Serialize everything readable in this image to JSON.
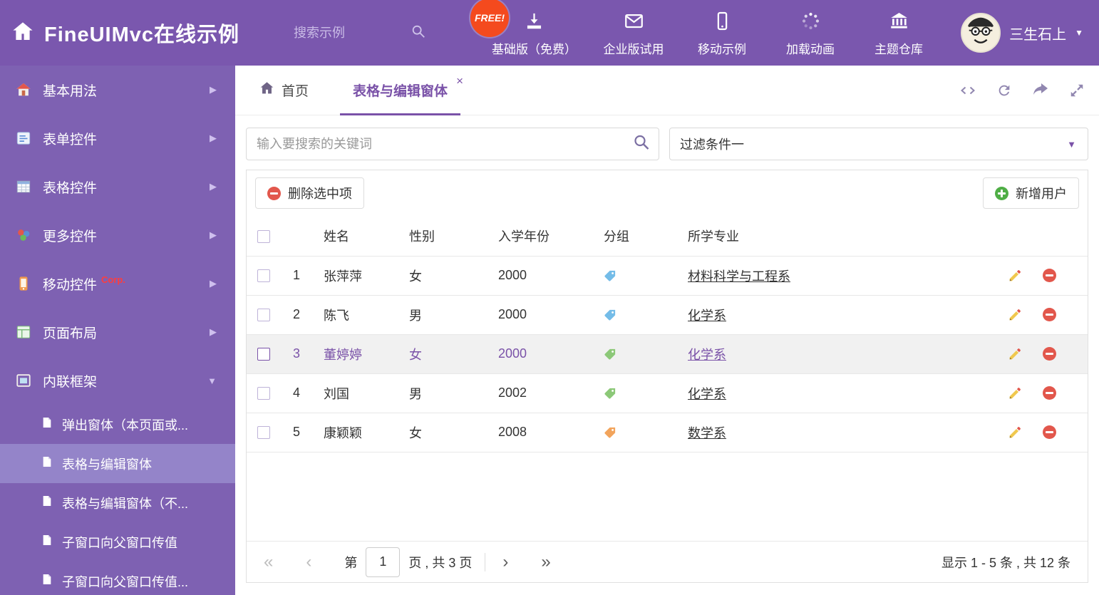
{
  "accent_color": "#7a52a8",
  "icons": {
    "caret_down": "▼",
    "arrow_right": "▶",
    "close": "×",
    "pg_first": "«",
    "pg_prev": "‹",
    "pg_next": "›",
    "pg_last": "»"
  },
  "header": {
    "title": "FineUIMvc在线示例",
    "search_placeholder": "搜索示例",
    "free_badge": "FREE!",
    "nav": [
      {
        "label": "基础版（免费）",
        "icon": "download-icon"
      },
      {
        "label": "企业版试用",
        "icon": "envelope-icon"
      },
      {
        "label": "移动示例",
        "icon": "mobile-icon"
      },
      {
        "label": "加载动画",
        "icon": "spinner-icon"
      },
      {
        "label": "主题仓库",
        "icon": "bank-icon"
      }
    ],
    "user_name": "三生石上"
  },
  "sidebar": {
    "items": [
      {
        "label": "基本用法"
      },
      {
        "label": "表单控件"
      },
      {
        "label": "表格控件"
      },
      {
        "label": "更多控件"
      },
      {
        "label": "移动控件",
        "badge": "Corp."
      },
      {
        "label": "页面布局"
      },
      {
        "label": "内联框架"
      }
    ],
    "subitems": [
      {
        "label": "弹出窗体（本页面或..."
      },
      {
        "label": "表格与编辑窗体"
      },
      {
        "label": "表格与编辑窗体（不..."
      },
      {
        "label": "子窗口向父窗口传值"
      },
      {
        "label": "子窗口向父窗口传值..."
      }
    ]
  },
  "tabs": {
    "home_label": "首页",
    "active_label": "表格与编辑窗体"
  },
  "filter_bar": {
    "search_placeholder": "输入要搜索的关键词",
    "filter_selected": "过滤条件一"
  },
  "toolbar": {
    "delete_label": "删除选中项",
    "add_label": "新增用户"
  },
  "table": {
    "headers": {
      "name": "姓名",
      "gender": "性别",
      "year": "入学年份",
      "group": "分组",
      "major": "所学专业"
    },
    "rows": [
      {
        "num": "1",
        "name": "张萍萍",
        "gender": "女",
        "year": "2000",
        "tag_color": "#74bce8",
        "major": "材料科学与工程系"
      },
      {
        "num": "2",
        "name": "陈飞",
        "gender": "男",
        "year": "2000",
        "tag_color": "#74bce8",
        "major": "化学系"
      },
      {
        "num": "3",
        "name": "董婷婷",
        "gender": "女",
        "year": "2000",
        "tag_color": "#8cc878",
        "major": "化学系"
      },
      {
        "num": "4",
        "name": "刘国",
        "gender": "男",
        "year": "2002",
        "tag_color": "#8cc878",
        "major": "化学系"
      },
      {
        "num": "5",
        "name": "康颖颖",
        "gender": "女",
        "year": "2008",
        "tag_color": "#f2a45c",
        "major": "数学系"
      }
    ]
  },
  "pagination": {
    "page_prefix": "第",
    "page_value": "1",
    "page_suffix": "页 , 共 3 页",
    "summary": "显示 1 - 5 条 , 共 12 条"
  }
}
